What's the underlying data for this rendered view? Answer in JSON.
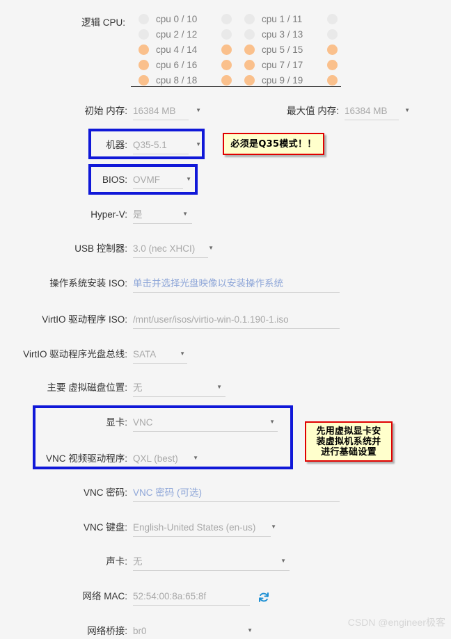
{
  "cpu": {
    "label": "逻辑 CPU:",
    "rows": [
      {
        "left": {
          "name": "cpu 0 / 10",
          "on": false
        },
        "right": {
          "name": "cpu 1 / 11",
          "on": false
        }
      },
      {
        "left": {
          "name": "cpu 2 / 12",
          "on": false
        },
        "right": {
          "name": "cpu 3 / 13",
          "on": false
        }
      },
      {
        "left": {
          "name": "cpu 4 / 14",
          "on": true
        },
        "right": {
          "name": "cpu 5 / 15",
          "on": true
        }
      },
      {
        "left": {
          "name": "cpu 6 / 16",
          "on": true
        },
        "right": {
          "name": "cpu 7 / 17",
          "on": true
        }
      },
      {
        "left": {
          "name": "cpu 8 / 18",
          "on": true
        },
        "right": {
          "name": "cpu 9 / 19",
          "on": true
        }
      }
    ]
  },
  "fields": {
    "initial_memory": {
      "label": "初始 内存:",
      "value": "16384 MB"
    },
    "max_memory": {
      "label": "最大值 内存:",
      "value": "16384 MB"
    },
    "machine": {
      "label": "机器:",
      "value": "Q35-5.1"
    },
    "bios": {
      "label": "BIOS:",
      "value": "OVMF"
    },
    "hyperv": {
      "label": "Hyper-V:",
      "value": "是"
    },
    "usb": {
      "label": "USB 控制器:",
      "value": "3.0 (nec XHCI)"
    },
    "os_iso": {
      "label": "操作系统安装 ISO:",
      "value": "单击并选择光盘映像以安装操作系统"
    },
    "virtio_iso": {
      "label": "VirtIO 驱动程序 ISO:",
      "value": "/mnt/user/isos/virtio-win-0.1.190-1.iso"
    },
    "virtio_bus": {
      "label": "VirtIO 驱动程序光盘总线:",
      "value": "SATA"
    },
    "disk_location": {
      "label": "主要 虚拟磁盘位置:",
      "value": "无"
    },
    "gpu": {
      "label": "显卡:",
      "value": "VNC"
    },
    "vnc_driver": {
      "label": "VNC 视频驱动程序:",
      "value": "QXL (best)"
    },
    "vnc_password": {
      "label": "VNC 密码:",
      "value": "VNC 密码 (可选)"
    },
    "vnc_keyboard": {
      "label": "VNC 键盘:",
      "value": "English-United States (en-us)"
    },
    "sound_card": {
      "label": "声卡:",
      "value": "无"
    },
    "network_mac": {
      "label": "网络 MAC:",
      "value": "52:54:00:8a:65:8f"
    },
    "network_bridge": {
      "label": "网络桥接:",
      "value": "br0"
    }
  },
  "annotations": {
    "machine_note": "必须是Q35模式！！",
    "gpu_note_l1": "先用虚拟显卡安",
    "gpu_note_l2": "装虚拟机系统并",
    "gpu_note_l3": "进行基础设置"
  },
  "icons": {
    "refresh": "refresh-icon",
    "caret": "▼"
  },
  "watermark": "CSDN @engineer极客",
  "colors": {
    "background": "#f5f5f5",
    "cpu_active": "#fac08c",
    "cpu_inactive": "#e9e9e9",
    "highlight_border": "#1018d8",
    "callout_bg": "#ffffcc",
    "callout_border": "#e00000",
    "link_text": "#8ea6d8",
    "value_text": "#a8a8a8",
    "label_text": "#333333",
    "refresh_icon": "#1e90d4"
  }
}
